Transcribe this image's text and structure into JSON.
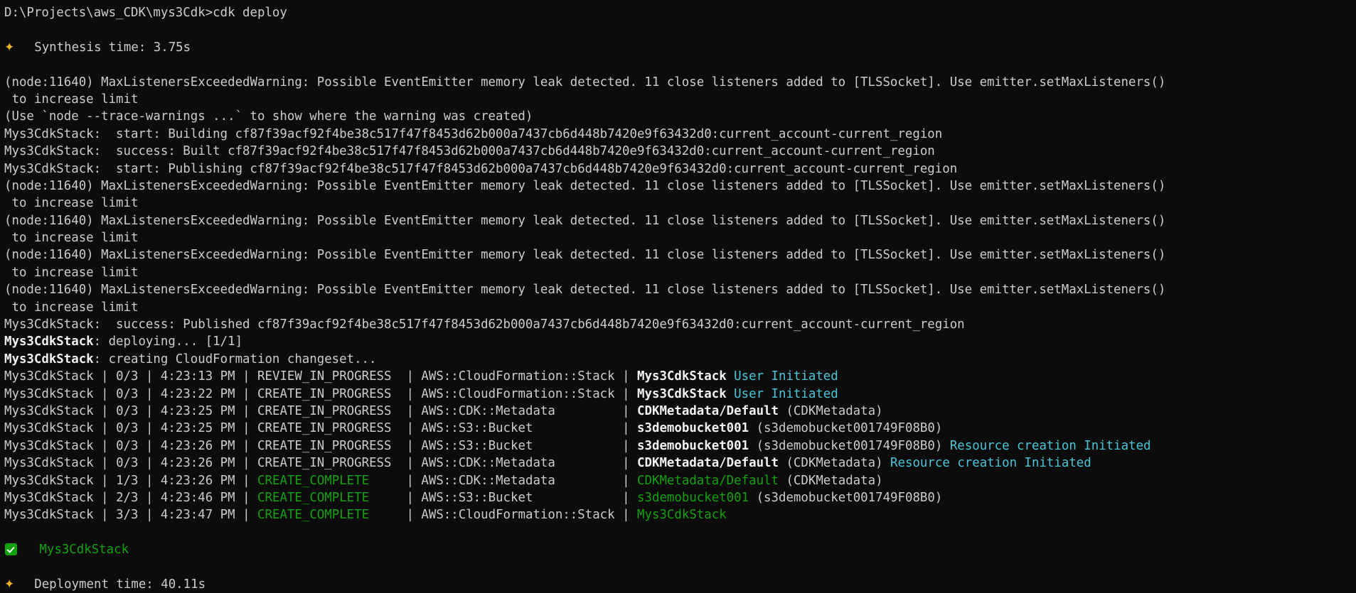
{
  "terminal": {
    "background_color": "#0c0c0c",
    "foreground_color": "#cccccc",
    "accent_green": "#13a10e",
    "accent_cyan": "#49c5d8",
    "accent_gold": "#f0b429",
    "prompt_line": "D:\\Projects\\aws_CDK\\mys3Cdk>cdk deploy",
    "synthesis_time": "Synthesis time: 3.75s",
    "deployment_time": "Deployment time: 40.11s",
    "warning_text": "(node:11640) MaxListenersExceededWarning: Possible EventEmitter memory leak detected. 11 close listeners added to [TLSSocket]. Use emitter.setMaxListeners()",
    "warning_continuation": " to increase limit",
    "trace_hint": "(Use `node --trace-warnings ...` to show where the warning was created)",
    "asset_hash": "cf87f39acf92f4be38c517f47f8453d62b000a7437cb6d448b7420e9f63432d0:current_account-current_region",
    "build_start": "Mys3CdkStack:  start: Building ",
    "build_success": "Mys3CdkStack:  success: Built ",
    "publish_start": "Mys3CdkStack:  start: Publishing ",
    "publish_success": "Mys3CdkStack:  success: Published ",
    "stack_name": "Mys3CdkStack",
    "deploying_label": ": deploying... [1/1]",
    "changeset_label": ": creating CloudFormation changeset...",
    "final_stack_name": "Mys3CdkStack"
  },
  "events": [
    {
      "stack": "Mys3CdkStack",
      "progress": "0/3",
      "time": "4:23:13 PM",
      "status": "REVIEW_IN_PROGRESS",
      "status_color": "white",
      "resource_type": "AWS::CloudFormation::Stack",
      "logical_id": "Mys3CdkStack",
      "logical_color": "bright",
      "physical_id": "",
      "reason": "User Initiated",
      "reason_color": "cyan"
    },
    {
      "stack": "Mys3CdkStack",
      "progress": "0/3",
      "time": "4:23:22 PM",
      "status": "CREATE_IN_PROGRESS",
      "status_color": "white",
      "resource_type": "AWS::CloudFormation::Stack",
      "logical_id": "Mys3CdkStack",
      "logical_color": "bright",
      "physical_id": "",
      "reason": "User Initiated",
      "reason_color": "cyan"
    },
    {
      "stack": "Mys3CdkStack",
      "progress": "0/3",
      "time": "4:23:25 PM",
      "status": "CREATE_IN_PROGRESS",
      "status_color": "white",
      "resource_type": "AWS::CDK::Metadata",
      "logical_id": "CDKMetadata/Default",
      "logical_color": "bright",
      "physical_id": "(CDKMetadata)",
      "reason": "",
      "reason_color": "cyan"
    },
    {
      "stack": "Mys3CdkStack",
      "progress": "0/3",
      "time": "4:23:25 PM",
      "status": "CREATE_IN_PROGRESS",
      "status_color": "white",
      "resource_type": "AWS::S3::Bucket",
      "logical_id": "s3demobucket001",
      "logical_color": "bright",
      "physical_id": "(s3demobucket001749F08B0)",
      "reason": "",
      "reason_color": "cyan"
    },
    {
      "stack": "Mys3CdkStack",
      "progress": "0/3",
      "time": "4:23:26 PM",
      "status": "CREATE_IN_PROGRESS",
      "status_color": "white",
      "resource_type": "AWS::S3::Bucket",
      "logical_id": "s3demobucket001",
      "logical_color": "bright",
      "physical_id": "(s3demobucket001749F08B0)",
      "reason": "Resource creation Initiated",
      "reason_color": "cyan"
    },
    {
      "stack": "Mys3CdkStack",
      "progress": "0/3",
      "time": "4:23:26 PM",
      "status": "CREATE_IN_PROGRESS",
      "status_color": "white",
      "resource_type": "AWS::CDK::Metadata",
      "logical_id": "CDKMetadata/Default",
      "logical_color": "bright",
      "physical_id": "(CDKMetadata)",
      "reason": "Resource creation Initiated",
      "reason_color": "cyan"
    },
    {
      "stack": "Mys3CdkStack",
      "progress": "1/3",
      "time": "4:23:26 PM",
      "status": "CREATE_COMPLETE",
      "status_color": "green",
      "resource_type": "AWS::CDK::Metadata",
      "logical_id": "CDKMetadata/Default",
      "logical_color": "green",
      "physical_id": "(CDKMetadata)",
      "reason": "",
      "reason_color": "cyan"
    },
    {
      "stack": "Mys3CdkStack",
      "progress": "2/3",
      "time": "4:23:46 PM",
      "status": "CREATE_COMPLETE",
      "status_color": "green",
      "resource_type": "AWS::S3::Bucket",
      "logical_id": "s3demobucket001",
      "logical_color": "green",
      "physical_id": "(s3demobucket001749F08B0)",
      "reason": "",
      "reason_color": "cyan"
    },
    {
      "stack": "Mys3CdkStack",
      "progress": "3/3",
      "time": "4:23:47 PM",
      "status": "CREATE_COMPLETE",
      "status_color": "green",
      "resource_type": "AWS::CloudFormation::Stack",
      "logical_id": "Mys3CdkStack",
      "logical_color": "green",
      "physical_id": "",
      "reason": "",
      "reason_color": "cyan"
    }
  ],
  "icons": {
    "sparkle": "✦",
    "check": "check-mark"
  }
}
